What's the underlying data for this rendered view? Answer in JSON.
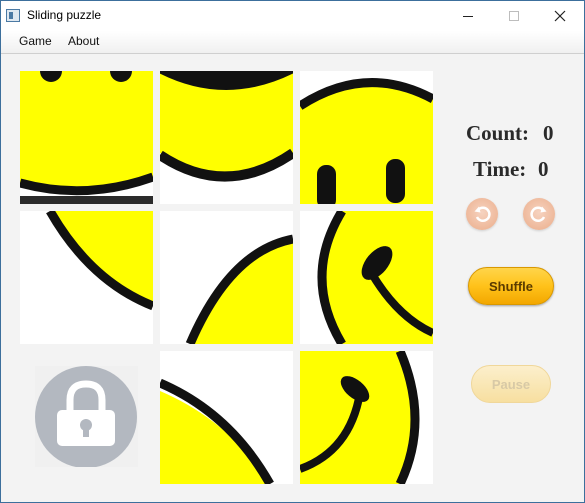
{
  "window": {
    "title": "Sliding puzzle"
  },
  "menu": {
    "items": [
      "Game",
      "About"
    ]
  },
  "stats": {
    "count_label": "Count:",
    "count_value": "0",
    "time_label": "Time:",
    "time_value": "0"
  },
  "controls": {
    "shuffle_label": "Shuffle",
    "pause_label": "Pause"
  },
  "board": {
    "grid": "3x3",
    "empty_tile_icon": "lock-icon",
    "tile_image": "smiley-face-fragment",
    "colors": {
      "face": "#ffff00",
      "outline": "#111111"
    }
  },
  "colors": {
    "shuffle_bg": "#ffc21a",
    "undo_redo_bg": "#eeb89a",
    "accent_border": "#3c6f9c"
  }
}
